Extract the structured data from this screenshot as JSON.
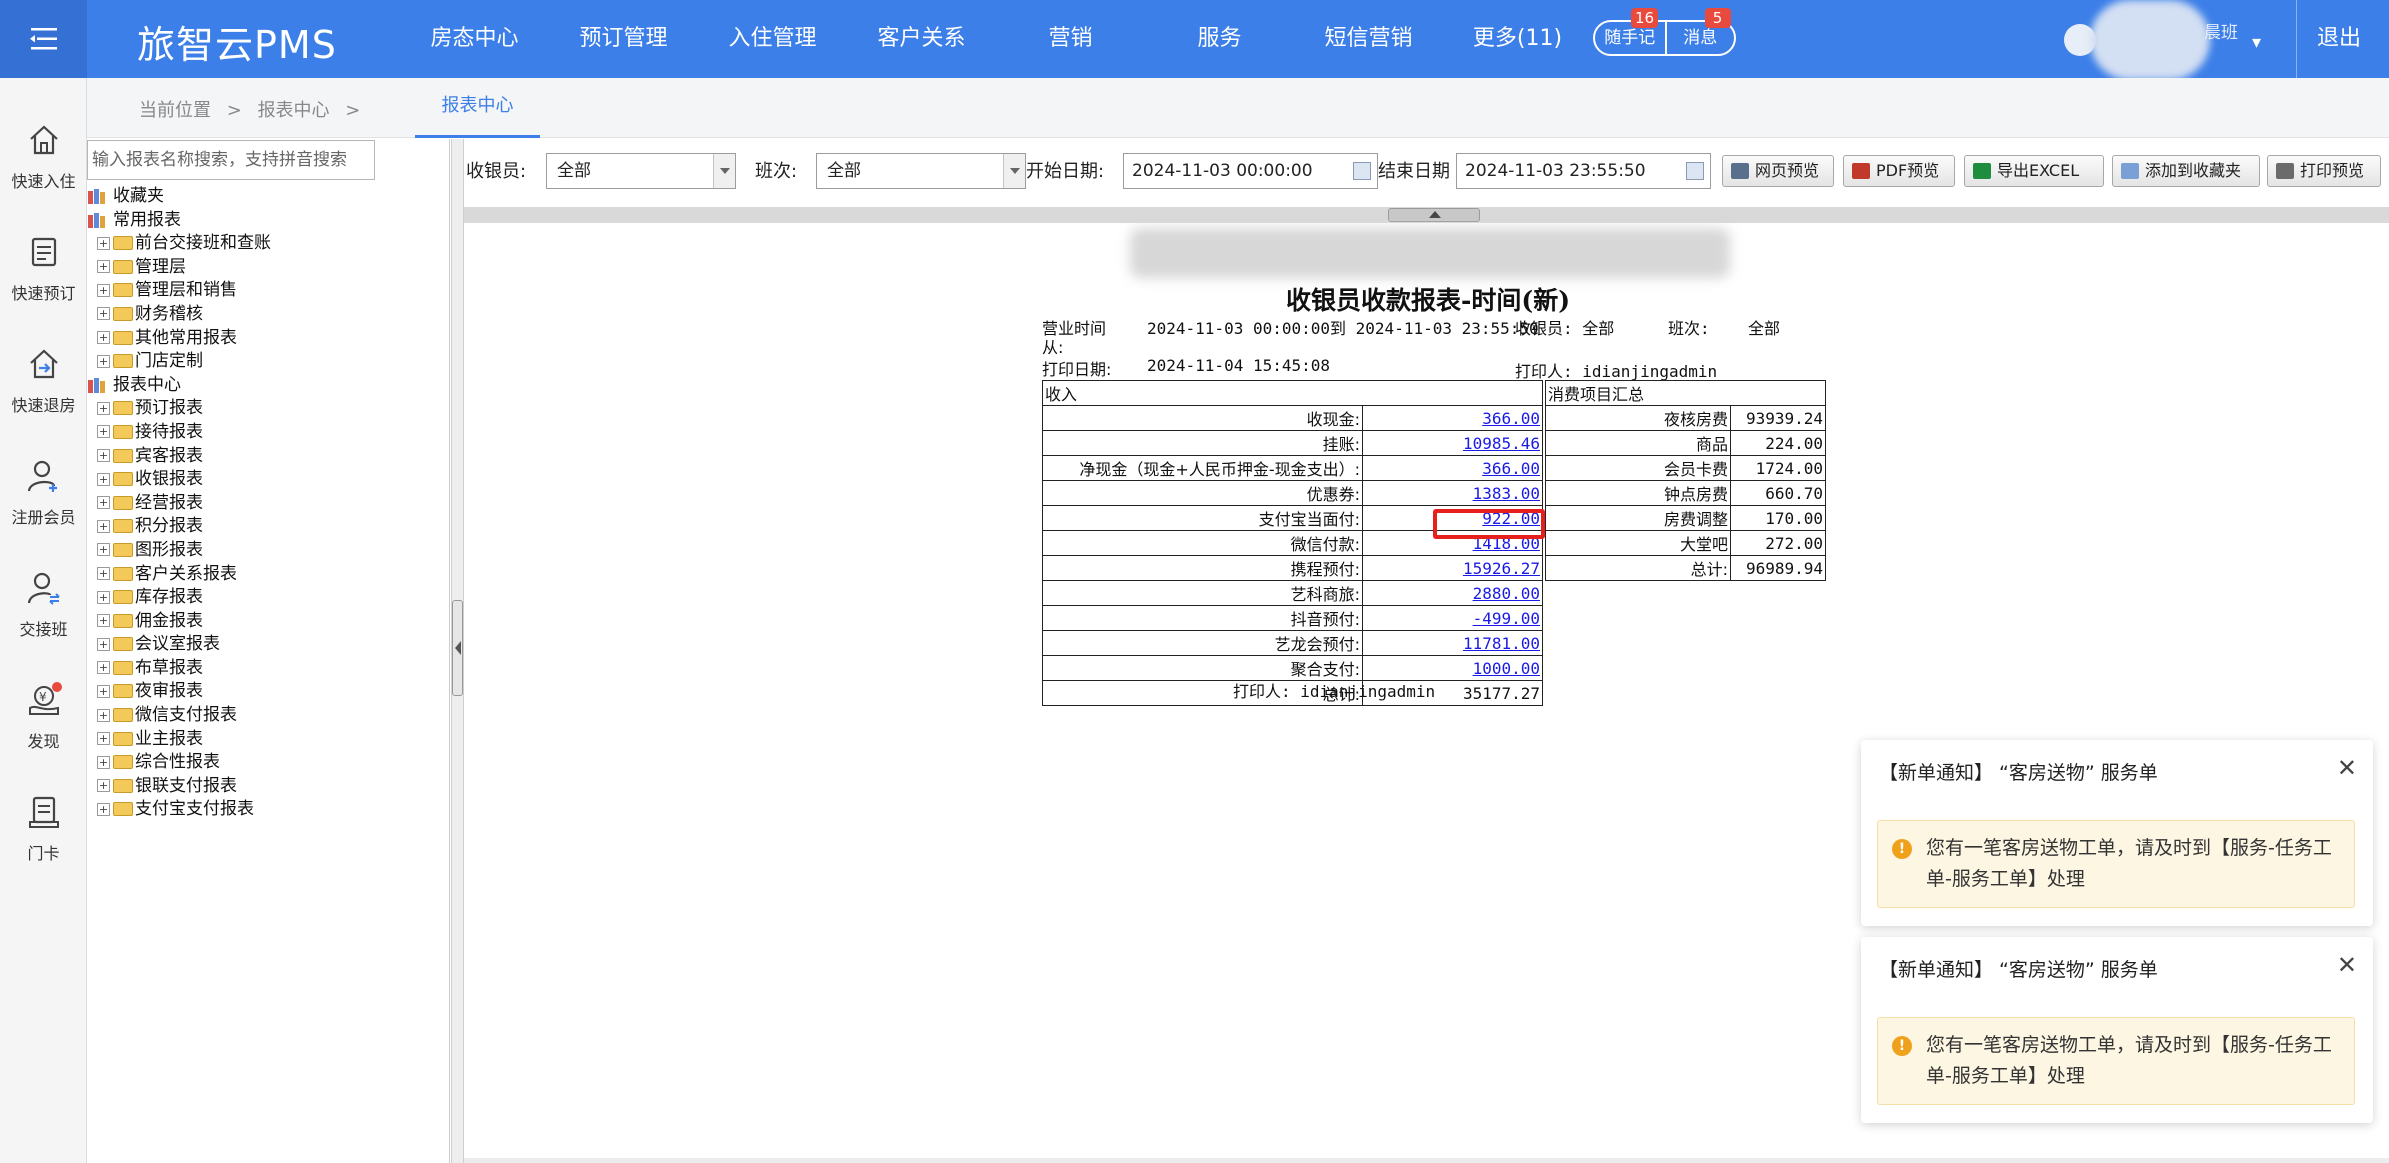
{
  "app": {
    "brand": "旅智云PMS",
    "nav": [
      "房态中心",
      "预订管理",
      "入住管理",
      "客户关系",
      "营销",
      "服务",
      "短信营销",
      "更多(11)"
    ],
    "notes_label": "随手记",
    "notes_badge": "16",
    "messages_label": "消息",
    "messages_badge": "5",
    "user_name": "晨班",
    "logout": "退出"
  },
  "sidebar": [
    {
      "label": "快速入住",
      "icon": "home-icon"
    },
    {
      "label": "快速预订",
      "icon": "booking-icon"
    },
    {
      "label": "快速退房",
      "icon": "checkout-icon"
    },
    {
      "label": "注册会员",
      "icon": "add-member-icon"
    },
    {
      "label": "交接班",
      "icon": "shift-handover-icon"
    },
    {
      "label": "发现",
      "icon": "discover-icon"
    },
    {
      "label": "门卡",
      "icon": "door-card-icon"
    }
  ],
  "breadcrumb": {
    "items": [
      "当前位置",
      ">",
      "报表中心",
      ">"
    ],
    "active_tab": "报表中心"
  },
  "tree": {
    "search_placeholder": "输入报表名称搜索，支持拼音搜索",
    "groups": [
      {
        "label": "收藏夹",
        "children": []
      },
      {
        "label": "常用报表",
        "children": [
          "前台交接班和查账",
          "管理层",
          "管理层和销售",
          "财务稽核",
          "其他常用报表",
          "门店定制"
        ]
      },
      {
        "label": "报表中心",
        "children": [
          "预订报表",
          "接待报表",
          "宾客报表",
          "收银报表",
          "经营报表",
          "积分报表",
          "图形报表",
          "客户关系报表",
          "库存报表",
          "佣金报表",
          "会议室报表",
          "布草报表",
          "夜审报表",
          "微信支付报表",
          "业主报表",
          "综合性报表",
          "银联支付报表",
          "支付宝支付报表"
        ]
      }
    ]
  },
  "filters": {
    "cashier_label": "收银员:",
    "cashier_value": "全部",
    "shift_label": "班次:",
    "shift_value": "全部",
    "start_label": "开始日期:",
    "start_value": "2024-11-03 00:00:00",
    "end_label": "结束日期",
    "end_value": "2024-11-03 23:55:50"
  },
  "toolbar": {
    "web_preview": "网页预览",
    "pdf_preview": "PDF预览",
    "export_excel": "导出EXCEL",
    "add_favorite": "添加到收藏夹",
    "print_preview": "打印预览"
  },
  "report": {
    "title": "收银员收款报表-时间(新)",
    "biz_time_label": "营业时间",
    "biz_time_from": "从:",
    "biz_time_value": "2024-11-03 00:00:00到 2024-11-03 23:55:50",
    "cashier": "收银员: 全部",
    "shift": "班次:",
    "shift_value": "全部",
    "print_date_label": "打印日期:",
    "print_date": "2024-11-04 15:45:08",
    "printer_top": "打印人: idianjingadmin",
    "printer_bottom": "打印人: idianjingadmin",
    "income_header": "收入",
    "income_rows": [
      {
        "label": "收现金:",
        "value": "366.00",
        "link": true
      },
      {
        "label": "挂账:",
        "value": "10985.46",
        "link": true
      },
      {
        "label": "净现金（现金+人民币押金-现金支出）:",
        "value": "366.00",
        "link": true
      },
      {
        "label": "优惠券:",
        "value": "1383.00",
        "link": true
      },
      {
        "label": "支付宝当面付:",
        "value": "922.00",
        "link": true
      },
      {
        "label": "微信付款:",
        "value": "1418.00",
        "link": true
      },
      {
        "label": "携程预付:",
        "value": "15926.27",
        "link": true
      },
      {
        "label": "艺科商旅:",
        "value": "2880.00",
        "link": true
      },
      {
        "label": "抖音预付:",
        "value": "-499.00",
        "link": true
      },
      {
        "label": "艺龙会预付:",
        "value": "11781.00",
        "link": true
      },
      {
        "label": "聚合支付:",
        "value": "1000.00",
        "link": true
      },
      {
        "label": "总计:",
        "value": "35177.27",
        "link": false
      }
    ],
    "consumption_header": "消费项目汇总",
    "consumption_rows": [
      {
        "label": "夜核房费",
        "value": "93939.24"
      },
      {
        "label": "商品",
        "value": "224.00"
      },
      {
        "label": "会员卡费",
        "value": "1724.00"
      },
      {
        "label": "钟点房费",
        "value": "660.70"
      },
      {
        "label": "房费调整",
        "value": "170.00"
      },
      {
        "label": "大堂吧",
        "value": "272.00"
      },
      {
        "label": "总计:",
        "value": "96989.94"
      }
    ]
  },
  "notifications": [
    {
      "title": "【新单通知】 “客房送物” 服务单",
      "message": "您有一笔客房送物工单，请及时到【服务-任务工单-服务工单】处理"
    },
    {
      "title": "【新单通知】 “客房送物” 服务单",
      "message": "您有一笔客房送物工单，请及时到【服务-任务工单-服务工单】处理"
    }
  ],
  "colors": {
    "topbar": "#3c7fe8",
    "highlight": "#e5201d",
    "link": "#1a1ae6",
    "notice_bg": "#fdf6e3"
  }
}
